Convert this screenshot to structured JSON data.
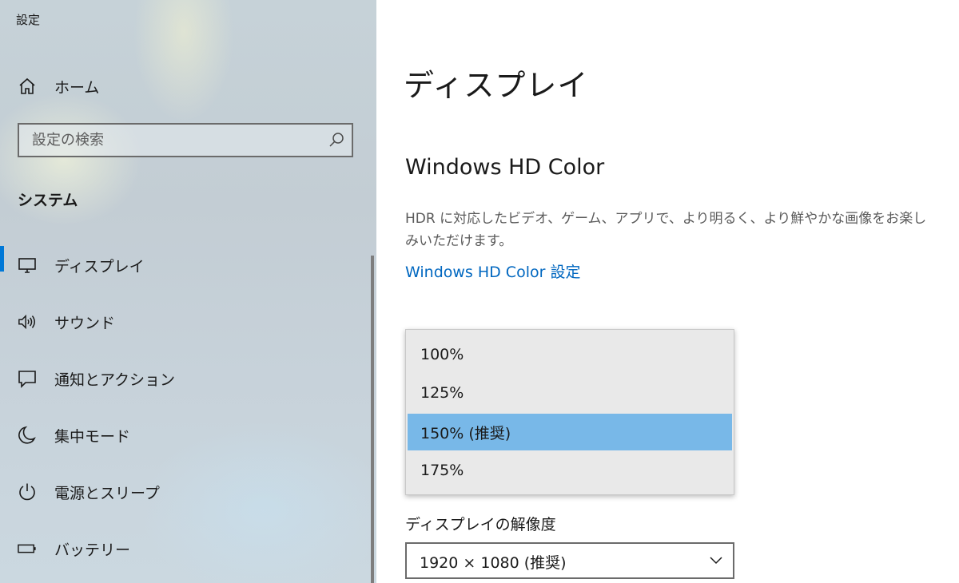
{
  "app": {
    "title": "設定"
  },
  "sidebar": {
    "home_label": "ホーム",
    "search": {
      "placeholder": "設定の検索",
      "value": ""
    },
    "section_title": "システム",
    "items": [
      {
        "label": "ディスプレイ",
        "icon": "monitor-icon",
        "selected": true
      },
      {
        "label": "サウンド",
        "icon": "speaker-icon",
        "selected": false
      },
      {
        "label": "通知とアクション",
        "icon": "notification-icon",
        "selected": false
      },
      {
        "label": "集中モード",
        "icon": "moon-icon",
        "selected": false
      },
      {
        "label": "電源とスリープ",
        "icon": "power-icon",
        "selected": false
      },
      {
        "label": "バッテリー",
        "icon": "battery-icon",
        "selected": false
      }
    ]
  },
  "main": {
    "page_title": "ディスプレイ",
    "hd_color": {
      "title": "Windows HD Color",
      "description": "HDR に対応したビデオ、ゲーム、アプリで、より明るく、より鮮やかな画像をお楽しみいただけます。",
      "link": "Windows HD Color 設定"
    },
    "scale_dropdown": {
      "options": [
        "100%",
        "125%",
        "150% (推奨)",
        "175%"
      ],
      "selected_index": 2
    },
    "resolution": {
      "label": "ディスプレイの解像度",
      "value": "1920 × 1080 (推奨)"
    }
  },
  "colors": {
    "accent": "#0078d7",
    "link": "#0067c0",
    "dropdown_highlight": "#78b8e8"
  }
}
